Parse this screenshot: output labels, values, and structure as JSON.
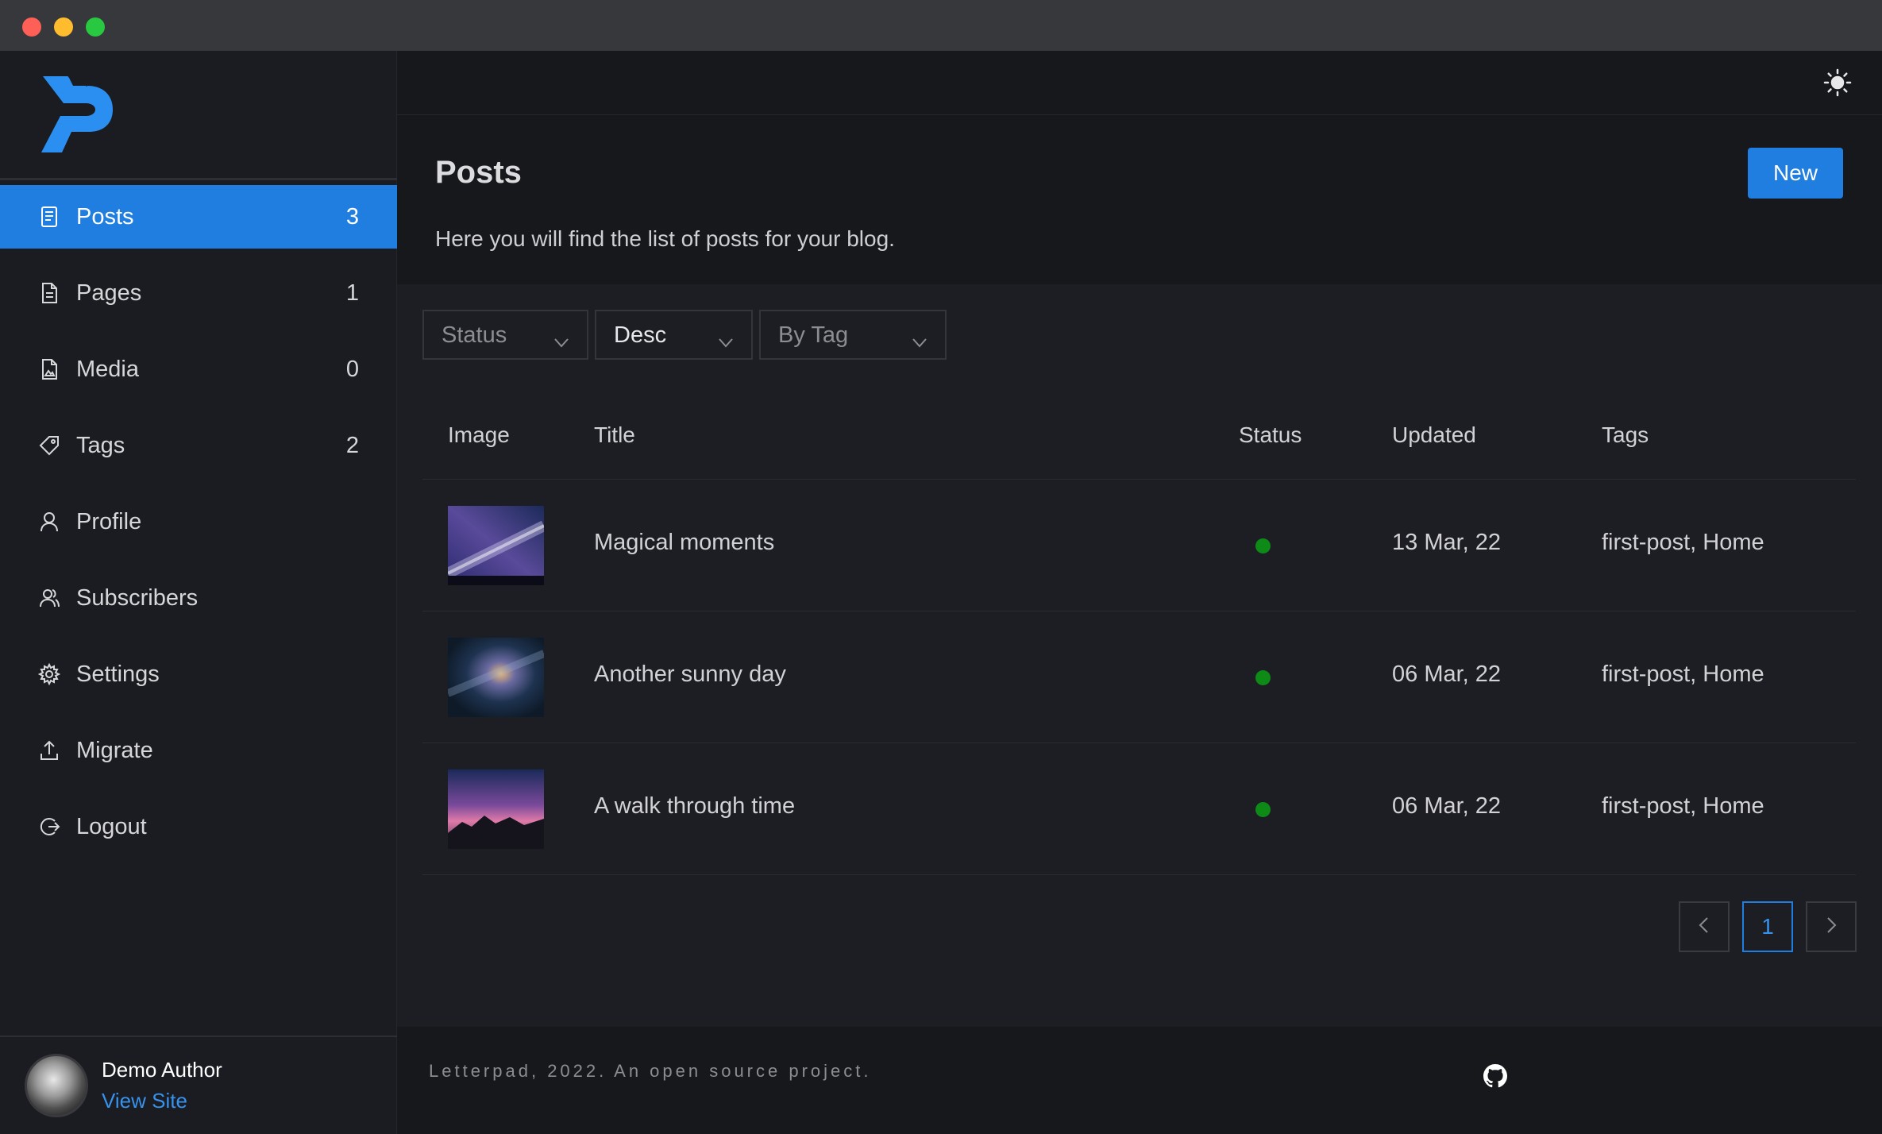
{
  "sidebar": {
    "items": [
      {
        "label": "Posts",
        "count": "3",
        "icon": "posts-icon"
      },
      {
        "label": "Pages",
        "count": "1",
        "icon": "page-icon"
      },
      {
        "label": "Media",
        "count": "0",
        "icon": "media-icon"
      },
      {
        "label": "Tags",
        "count": "2",
        "icon": "tag-icon"
      },
      {
        "label": "Profile",
        "count": "",
        "icon": "user-icon"
      },
      {
        "label": "Subscribers",
        "count": "",
        "icon": "subscribers-icon"
      },
      {
        "label": "Settings",
        "count": "",
        "icon": "gear-icon"
      },
      {
        "label": "Migrate",
        "count": "",
        "icon": "upload-icon"
      },
      {
        "label": "Logout",
        "count": "",
        "icon": "logout-icon"
      }
    ],
    "user": {
      "name": "Demo Author",
      "link": "View Site"
    }
  },
  "header": {
    "title": "Posts",
    "description": "Here you will find the list of posts for your blog.",
    "new_label": "New",
    "theme_icon": "sun-icon"
  },
  "filters": {
    "status": "Status",
    "order": "Desc",
    "tag": "By Tag"
  },
  "table": {
    "columns": [
      "Image",
      "Title",
      "Status",
      "Updated",
      "Tags"
    ],
    "rows": [
      {
        "title": "Magical moments",
        "status": "published",
        "updated": "13 Mar, 22",
        "tags": "first-post, Home"
      },
      {
        "title": "Another sunny day",
        "status": "published",
        "updated": "06 Mar, 22",
        "tags": "first-post, Home"
      },
      {
        "title": "A walk through time",
        "status": "published",
        "updated": "06 Mar, 22",
        "tags": "first-post, Home"
      }
    ]
  },
  "pagination": {
    "current": "1"
  },
  "footer": {
    "text": "Letterpad, 2022. An open source project.",
    "icon": "github-icon"
  },
  "colors": {
    "accent": "#1f7ee0",
    "status_published": "#0e8a17",
    "link": "#3792ee"
  }
}
